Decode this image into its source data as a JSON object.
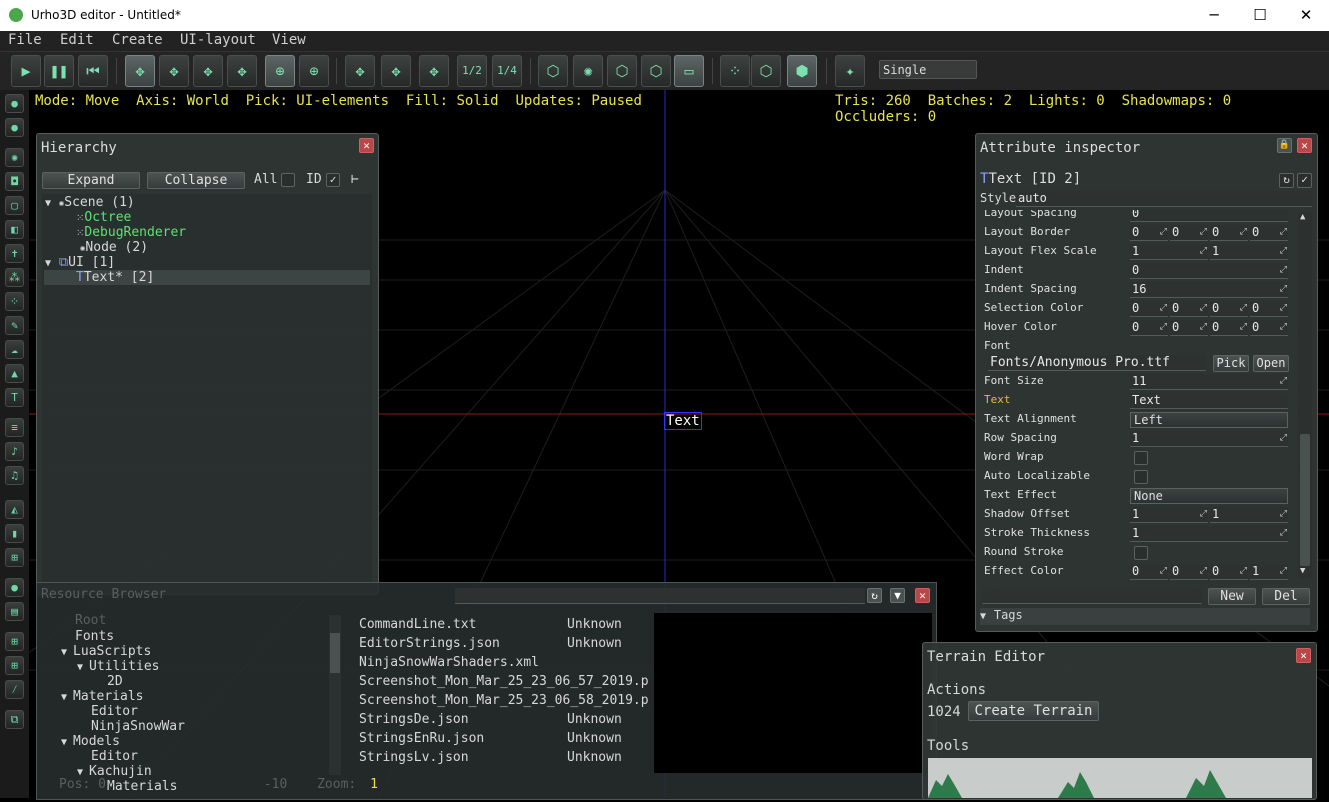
{
  "window": {
    "title": "Urho3D editor - Untitled*",
    "minimize_glyph": "─",
    "maximize_glyph": "☐",
    "close_glyph": "✕"
  },
  "menu": [
    "File",
    "Edit",
    "Create",
    "UI-layout",
    "View"
  ],
  "toolbar": {
    "view_mode": "Single",
    "icons": [
      "play-icon",
      "pause-icon",
      "rewind-icon",
      "move-icon",
      "rotate-icon",
      "scale-icon",
      "select-icon",
      "local-axis-icon",
      "world-axis-icon",
      "snap-move-icon",
      "snap-rotate-icon",
      "snap-scale-icon",
      "snap-half-icon",
      "snap-quarter-icon",
      "pick-geometry-icon",
      "pick-lights-icon",
      "pick-zones-icon",
      "pick-rigidbodies-icon",
      "pick-ui-icon",
      "fill-points-icon",
      "fill-wireframe-icon",
      "fill-solid-icon",
      "camera-icon"
    ],
    "labels": {
      "half": "1/2",
      "quarter": "1/4"
    }
  },
  "status": {
    "mode": "Mode: Move",
    "axis": "Axis: World",
    "pick": "Pick: UI-elements",
    "fill": "Fill: Solid",
    "updates": "Updates: Paused",
    "tris": "Tris: 260",
    "batches": "Batches: 2",
    "lights": "Lights: 0",
    "shadowmaps": "Shadowmaps: 0",
    "occluders": "Occluders: 0"
  },
  "viewport": {
    "ui_text": "Text"
  },
  "hierarchy": {
    "title": "Hierarchy",
    "expand_label": "Expand",
    "collapse_label": "Collapse",
    "all_label": "All",
    "id_label": "ID",
    "id_checked": "✓",
    "tree": [
      {
        "label": "Scene (1)",
        "indent": 0,
        "color": "#e0e0e0",
        "icon": "scene-icon"
      },
      {
        "label": "Octree",
        "indent": 1,
        "color": "#5fe072",
        "icon": "component-icon"
      },
      {
        "label": "DebugRenderer",
        "indent": 1,
        "color": "#5fe072",
        "icon": "component-icon"
      },
      {
        "label": "Node (2)",
        "indent": 1,
        "color": "#e0e0e0",
        "icon": "node-icon"
      },
      {
        "label": "UI [1]",
        "indent": 0,
        "color": "#e0e0e0",
        "icon": "ui-root-icon"
      },
      {
        "label": "Text* [2]",
        "indent": 1,
        "color": "#e0e0e0",
        "icon": "text-icon"
      }
    ]
  },
  "attribute_inspector": {
    "title": "Attribute inspector",
    "heading": "Text  [ID 2]",
    "style_label": "Style",
    "style_value": "auto",
    "partial_row": {
      "label": "Layout Spacing",
      "value": "0"
    },
    "rows": [
      {
        "label": "Layout Border",
        "values": [
          "0",
          "0",
          "0",
          "0"
        ]
      },
      {
        "label": "Layout Flex Scale",
        "values": [
          "1",
          "1"
        ]
      },
      {
        "label": "Indent",
        "values": [
          "0"
        ]
      },
      {
        "label": "Indent Spacing",
        "values": [
          "16"
        ]
      },
      {
        "label": "Selection Color",
        "values": [
          "0",
          "0",
          "0",
          "0"
        ]
      },
      {
        "label": "Hover Color",
        "values": [
          "0",
          "0",
          "0",
          "0"
        ]
      }
    ],
    "font_label": "Font",
    "font_value": "Fonts/Anonymous Pro.ttf",
    "pick_label": "Pick",
    "open_label": "Open",
    "rows2": [
      {
        "label": "Font Size",
        "type": "num",
        "values": [
          "11"
        ]
      },
      {
        "label": "Text",
        "type": "text",
        "values": [
          "Text"
        ],
        "highlight": true
      },
      {
        "label": "Text Alignment",
        "type": "drop",
        "values": [
          "Left"
        ]
      },
      {
        "label": "Row Spacing",
        "type": "num",
        "values": [
          "1"
        ]
      },
      {
        "label": "Word Wrap",
        "type": "check",
        "values": []
      },
      {
        "label": "Auto Localizable",
        "type": "check",
        "values": []
      },
      {
        "label": "Text Effect",
        "type": "drop",
        "values": [
          "None"
        ]
      },
      {
        "label": "Shadow Offset",
        "type": "num",
        "values": [
          "1",
          "1"
        ]
      },
      {
        "label": "Stroke Thickness",
        "type": "num",
        "values": [
          "1"
        ]
      },
      {
        "label": "Round Stroke",
        "type": "check",
        "values": []
      },
      {
        "label": "Effect Color",
        "type": "num",
        "values": [
          "0",
          "0",
          "0",
          "1"
        ]
      }
    ],
    "new_label": "New",
    "del_label": "Del",
    "tags_label": "Tags"
  },
  "resource_browser": {
    "title": "Resource Browser",
    "root_label": "Root",
    "folders": [
      {
        "label": "Fonts",
        "indent": 1,
        "expanded": false
      },
      {
        "label": "LuaScripts",
        "indent": 1,
        "expanded": true
      },
      {
        "label": "Utilities",
        "indent": 2,
        "expanded": true
      },
      {
        "label": "2D",
        "indent": 3,
        "expanded": false
      },
      {
        "label": "Materials",
        "indent": 1,
        "expanded": true
      },
      {
        "label": "Editor",
        "indent": 2,
        "expanded": false
      },
      {
        "label": "NinjaSnowWar",
        "indent": 2,
        "expanded": false
      },
      {
        "label": "Models",
        "indent": 1,
        "expanded": true
      },
      {
        "label": "Editor",
        "indent": 2,
        "expanded": false
      },
      {
        "label": "Kachujin",
        "indent": 2,
        "expanded": true
      },
      {
        "label": "Materials",
        "indent": 3,
        "expanded": false
      }
    ],
    "files": [
      {
        "name": "CommandLine.txt",
        "type": "Unknown"
      },
      {
        "name": "EditorStrings.json",
        "type": "Unknown"
      },
      {
        "name": "NinjaSnowWarShaders.xml",
        "type": ""
      },
      {
        "name": "Screenshot_Mon_Mar_25_23_06_57_2019.p",
        "type": ""
      },
      {
        "name": "Screenshot_Mon_Mar_25_23_06_58_2019.p",
        "type": ""
      },
      {
        "name": "StringsDe.json",
        "type": "Unknown"
      },
      {
        "name": "StringsEnRu.json",
        "type": "Unknown"
      },
      {
        "name": "StringsLv.json",
        "type": "Unknown"
      }
    ],
    "status_pos": "Pos: 0",
    "status_num": "-10",
    "status_zoom": "Zoom:",
    "status_zoom_value": "1"
  },
  "terrain_editor": {
    "title": "Terrain Editor",
    "actions_label": "Actions",
    "size_value": "1024",
    "create_label": "Create Terrain",
    "tools_label": "Tools"
  },
  "colors": {
    "status_yellow": "#e8e34a",
    "accent_teal": "#7de0b0",
    "close_red": "#b84848",
    "green_component": "#5fe072"
  }
}
